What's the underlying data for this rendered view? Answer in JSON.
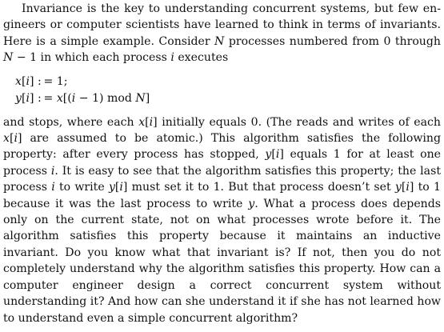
{
  "doc": {
    "para1": [
      {
        "t": "Invariance is the key to understanding concurrent systems, but few en­gineers or computer scientists have learned to think in terms of invariants. Here is a simple example. Consider "
      },
      {
        "t": "N",
        "v": true
      },
      {
        "t": " processes numbered from 0 through "
      },
      {
        "t": "N",
        "v": true
      },
      {
        "t": " − 1 in which each process "
      },
      {
        "t": "i",
        "v": true
      },
      {
        "t": " executes"
      }
    ],
    "equations": [
      [
        {
          "t": "x",
          "v": true
        },
        {
          "t": "["
        },
        {
          "t": "i",
          "v": true
        },
        {
          "t": "]"
        },
        {
          "t": " : = 1;"
        }
      ],
      [
        {
          "t": "y",
          "v": true
        },
        {
          "t": "["
        },
        {
          "t": "i",
          "v": true
        },
        {
          "t": "]"
        },
        {
          "t": " : = "
        },
        {
          "t": "x",
          "v": true
        },
        {
          "t": "[("
        },
        {
          "t": "i",
          "v": true
        },
        {
          "t": " − 1) mod "
        },
        {
          "t": "N",
          "v": true
        },
        {
          "t": "]"
        }
      ]
    ],
    "para2": [
      {
        "t": "and stops, where each "
      },
      {
        "t": "x",
        "v": true
      },
      {
        "t": "["
      },
      {
        "t": "i",
        "v": true
      },
      {
        "t": "]"
      },
      {
        "t": " initially equals 0. (The reads and writes of each "
      },
      {
        "t": "x",
        "v": true
      },
      {
        "t": "["
      },
      {
        "t": "i",
        "v": true
      },
      {
        "t": "]"
      },
      {
        "t": " are assumed to be atomic.) This algorithm satisfies the following property: after every process has stopped, "
      },
      {
        "t": "y",
        "v": true
      },
      {
        "t": "["
      },
      {
        "t": "i",
        "v": true
      },
      {
        "t": "]"
      },
      {
        "t": " equals 1 for at least one process "
      },
      {
        "t": "i",
        "v": true
      },
      {
        "t": ". It is easy to see that the algorithm satisfies this property; the last process "
      },
      {
        "t": "i",
        "v": true
      },
      {
        "t": " to write "
      },
      {
        "t": "y",
        "v": true
      },
      {
        "t": "["
      },
      {
        "t": "i",
        "v": true
      },
      {
        "t": "]"
      },
      {
        "t": " must set it to 1. But that process doesn’t set "
      },
      {
        "t": "y",
        "v": true
      },
      {
        "t": "["
      },
      {
        "t": "i",
        "v": true
      },
      {
        "t": "]"
      },
      {
        "t": " to 1 because it was the last process to write "
      },
      {
        "t": "y",
        "v": true
      },
      {
        "t": ". What a process does depends only on the current state, not on what processes wrote before it. The algorithm satisfies this property because it maintains an inductive invariant. Do you know what that invariant is? If not, then you do not completely understand why the algorithm satisfies this property. How can a computer engineer design a correct concurrent system without understanding it? And how can she understand it if she has not learned how to understand even a simple concurrent algorithm?"
      }
    ]
  }
}
